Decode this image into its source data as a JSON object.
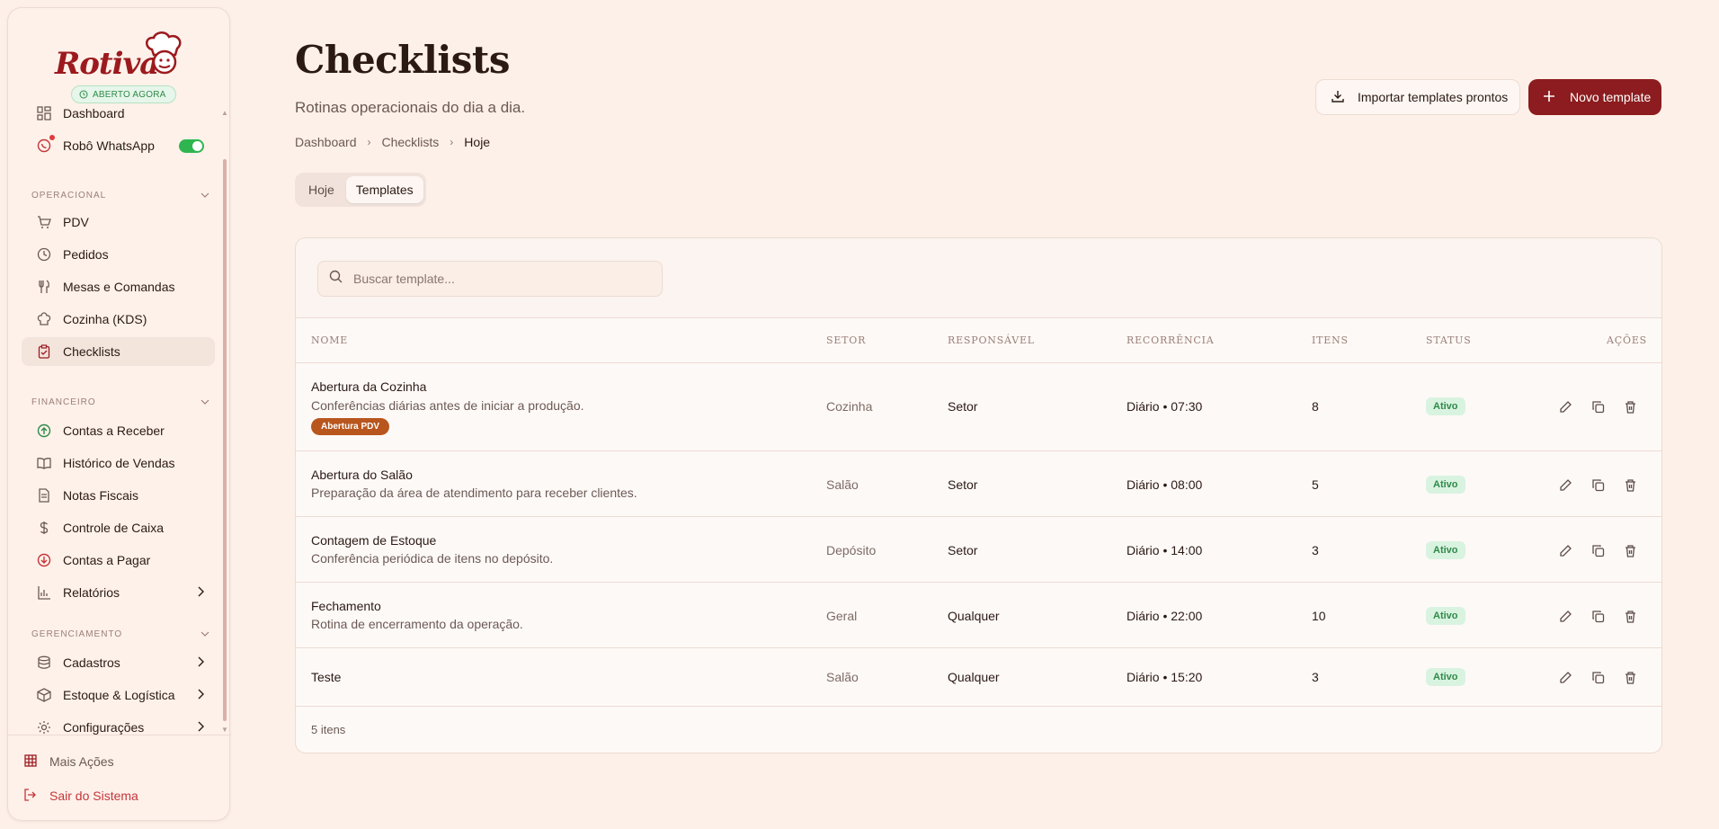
{
  "brand": {
    "name": "Rotiva",
    "status": "ABERTO AGORA"
  },
  "sidebar": {
    "top_items": [
      {
        "label": "Dashboard",
        "icon": "dashboard-icon"
      },
      {
        "label": "Robô WhatsApp",
        "icon": "whatsapp-icon",
        "toggle_on": true
      }
    ],
    "sections": [
      {
        "title": "OPERACIONAL",
        "items": [
          "PDV",
          "Pedidos",
          "Mesas e Comandas",
          "Cozinha (KDS)",
          "Checklists"
        ]
      },
      {
        "title": "FINANCEIRO",
        "items": [
          "Contas a Receber",
          "Histórico de Vendas",
          "Notas Fiscais",
          "Controle de Caixa",
          "Contas a Pagar",
          "Relatórios"
        ]
      },
      {
        "title": "GERENCIAMENTO",
        "items": [
          "Cadastros",
          "Estoque & Logística",
          "Configurações"
        ]
      }
    ],
    "active_item": "Checklists",
    "footer": {
      "more": "Mais Ações",
      "logout": "Sair do Sistema"
    }
  },
  "header": {
    "title": "Checklists",
    "subtitle": "Rotinas operacionais do dia a dia.",
    "breadcrumb": [
      "Dashboard",
      "Checklists",
      "Hoje"
    ],
    "import_button": "Importar templates prontos",
    "new_button": "Novo template"
  },
  "tabs": [
    {
      "label": "Hoje",
      "active": false
    },
    {
      "label": "Templates",
      "active": true
    }
  ],
  "search": {
    "placeholder": "Buscar template..."
  },
  "table": {
    "columns": [
      "NOME",
      "SETOR",
      "RESPONSÁVEL",
      "RECORRÊNCIA",
      "ITENS",
      "STATUS",
      "AÇÕES"
    ],
    "rows": [
      {
        "name": "Abertura da Cozinha",
        "description": "Conferências diárias antes de iniciar a produção.",
        "tag": "Abertura PDV",
        "sector": "Cozinha",
        "responsible": "Setor",
        "recurrence": "Diário • 07:30",
        "items": "8",
        "status": "Ativo"
      },
      {
        "name": "Abertura do Salão",
        "description": "Preparação da área de atendimento para receber clientes.",
        "tag": "",
        "sector": "Salão",
        "responsible": "Setor",
        "recurrence": "Diário • 08:00",
        "items": "5",
        "status": "Ativo"
      },
      {
        "name": "Contagem de Estoque",
        "description": "Conferência periódica de itens no depósito.",
        "tag": "",
        "sector": "Depósito",
        "responsible": "Setor",
        "recurrence": "Diário • 14:00",
        "items": "3",
        "status": "Ativo"
      },
      {
        "name": "Fechamento",
        "description": "Rotina de encerramento da operação.",
        "tag": "",
        "sector": "Geral",
        "responsible": "Qualquer",
        "recurrence": "Diário • 22:00",
        "items": "10",
        "status": "Ativo"
      },
      {
        "name": "Teste",
        "description": "",
        "tag": "",
        "sector": "Salão",
        "responsible": "Qualquer",
        "recurrence": "Diário • 15:20",
        "items": "3",
        "status": "Ativo"
      }
    ],
    "footer": "5 itens"
  },
  "colors": {
    "accent": "#8c1c1f",
    "success": "#2f8a48",
    "tag": "#b8561e"
  }
}
